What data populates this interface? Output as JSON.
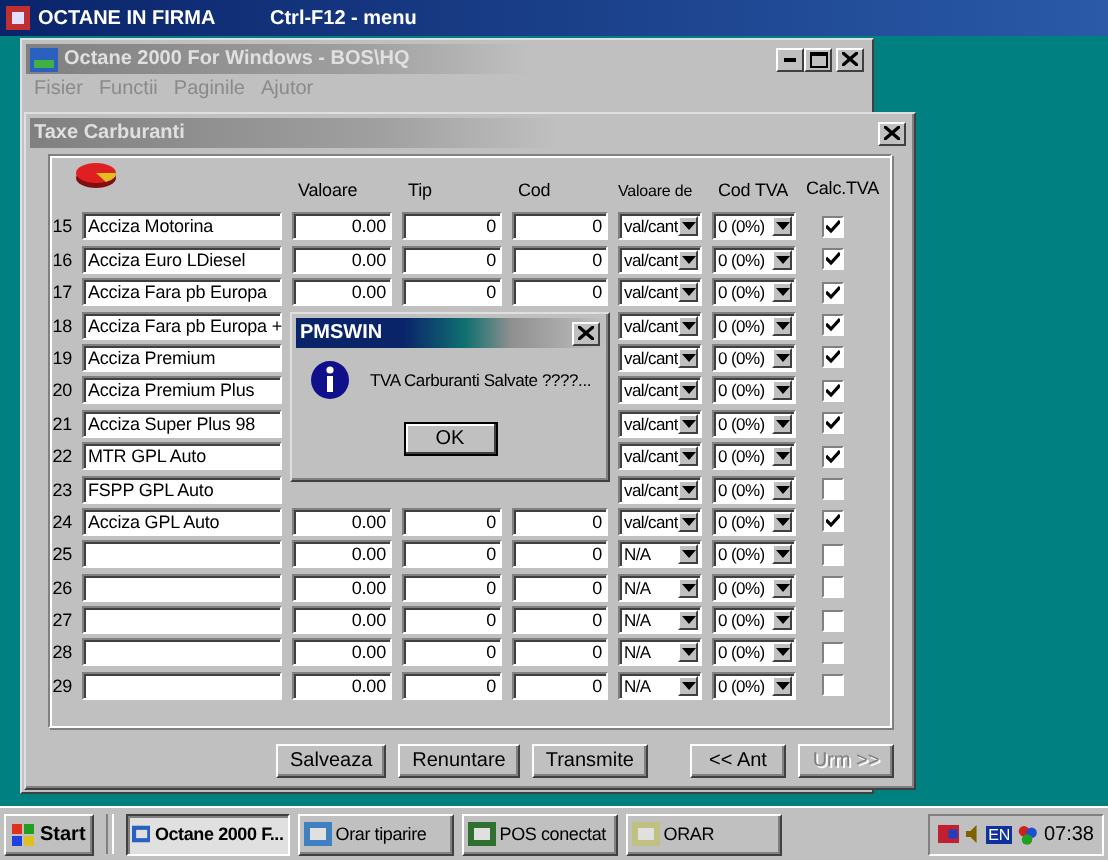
{
  "top_bar": {
    "title": "OCTANE IN FIRMA",
    "hint": "Ctrl-F12 - menu"
  },
  "main_window": {
    "title": "Octane 2000 For Windows - BOS\\HQ",
    "menu": [
      {
        "label": "Fisier",
        "disabled": true
      },
      {
        "label": "Functii",
        "disabled": true
      },
      {
        "label": "Paginile",
        "disabled": true
      },
      {
        "label": "Ajutor",
        "disabled": true
      }
    ]
  },
  "form_window": {
    "title": "Taxe Carburanti",
    "columns": [
      "Valoare",
      "Tip",
      "Cod",
      "Valoare de",
      "Cod TVA",
      "Calc.TVA"
    ],
    "rows": [
      {
        "number": "15",
        "name": "Acciza Motorina",
        "valoare": "0.00",
        "tip": "0",
        "cod": "0",
        "valoare_de": "val/cant",
        "cod_tva": "0 (0%)",
        "calc_tva": true
      },
      {
        "number": "16",
        "name": "Acciza Euro LDiesel",
        "valoare": "0.00",
        "tip": "0",
        "cod": "0",
        "valoare_de": "val/cant",
        "cod_tva": "0 (0%)",
        "calc_tva": true
      },
      {
        "number": "17",
        "name": "Acciza Fara pb Europa",
        "valoare": "0.00",
        "tip": "0",
        "cod": "0",
        "valoare_de": "val/cant",
        "cod_tva": "0 (0%)",
        "calc_tva": true
      },
      {
        "number": "18",
        "name": "Acciza Fara pb Europa +",
        "valoare_de": "val/cant",
        "cod_tva": "0 (0%)",
        "calc_tva": true
      },
      {
        "number": "19",
        "name": "Acciza Premium",
        "valoare_de": "val/cant",
        "cod_tva": "0 (0%)",
        "calc_tva": true
      },
      {
        "number": "20",
        "name": "Acciza Premium Plus",
        "valoare_de": "val/cant",
        "cod_tva": "0 (0%)",
        "calc_tva": true
      },
      {
        "number": "21",
        "name": "Acciza Super Plus 98",
        "valoare_de": "val/cant",
        "cod_tva": "0 (0%)",
        "calc_tva": true
      },
      {
        "number": "22",
        "name": "MTR GPL Auto",
        "valoare_de": "val/cant",
        "cod_tva": "0 (0%)",
        "calc_tva": true
      },
      {
        "number": "23",
        "name": "FSPP GPL Auto",
        "valoare_de": "val/cant",
        "cod_tva": "0 (0%)",
        "calc_tva": false
      },
      {
        "number": "24",
        "name": "Acciza GPL Auto",
        "valoare": "0.00",
        "tip": "0",
        "cod": "0",
        "valoare_de": "val/cant",
        "cod_tva": "0 (0%)",
        "calc_tva": true
      },
      {
        "number": "25",
        "valoare": "0.00",
        "tip": "0",
        "cod": "0",
        "valoare_de": "N/A",
        "cod_tva": "0 (0%)",
        "calc_tva": false
      },
      {
        "number": "26",
        "valoare": "0.00",
        "tip": "0",
        "cod": "0",
        "valoare_de": "N/A",
        "cod_tva": "0 (0%)",
        "calc_tva": false
      },
      {
        "number": "27",
        "valoare": "0.00",
        "tip": "0",
        "cod": "0",
        "valoare_de": "N/A",
        "cod_tva": "0 (0%)",
        "calc_tva": false
      },
      {
        "number": "28",
        "valoare": "0.00",
        "tip": "0",
        "cod": "0",
        "valoare_de": "N/A",
        "cod_tva": "0 (0%)",
        "calc_tva": false
      },
      {
        "number": "29",
        "valoare": "0.00",
        "tip": "0",
        "cod": "0",
        "valoare_de": "N/A",
        "cod_tva": "0 (0%)",
        "calc_tva": false
      }
    ],
    "actions": [
      {
        "label": "Salveaza",
        "disabled": false
      },
      {
        "label": "Renuntare",
        "disabled": false
      },
      {
        "label": "Transmite",
        "disabled": false
      }
    ],
    "navigation": [
      {
        "label": "<< Ant",
        "disabled": false
      },
      {
        "label": "Urm >>",
        "disabled": true
      }
    ]
  },
  "dialog": {
    "title": "PMSWIN",
    "message": "TVA Carburanti Salvate ????...",
    "button": "OK"
  },
  "taskbar": {
    "start": "Start",
    "tasks": [
      {
        "label": "Octane 2000 F...",
        "selected": true
      },
      {
        "label": "Orar tiparire",
        "selected": false
      },
      {
        "label": "POS conectat",
        "selected": false
      },
      {
        "label": "ORAR",
        "selected": false
      }
    ],
    "language": "EN",
    "clock": "07:38"
  }
}
